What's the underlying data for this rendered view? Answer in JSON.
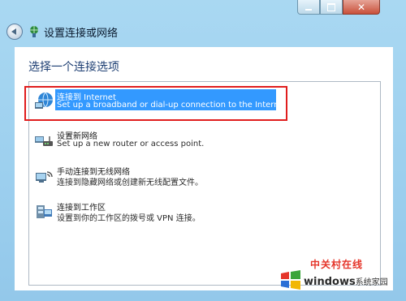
{
  "window": {
    "title": "设置连接或网络",
    "close_glyph": "✕"
  },
  "page": {
    "heading": "选择一个连接选项"
  },
  "options": [
    {
      "title": "连接到 Internet",
      "description": "Set up a broadband or dial-up connection to the Internet.",
      "icon": "globe-network-icon",
      "selected": true
    },
    {
      "title": "设置新网络",
      "description": "Set up a new router or access point.",
      "icon": "router-icon",
      "selected": false
    },
    {
      "title": "手动连接到无线网络",
      "description": "连接到隐藏网络或创建新无线配置文件。",
      "icon": "wireless-network-icon",
      "selected": false
    },
    {
      "title": "连接到工作区",
      "description": "设置到你的工作区的拨号或 VPN 连接。",
      "icon": "workplace-vpn-icon",
      "selected": false
    }
  ],
  "watermark": {
    "line1": "中关村在线",
    "brand": "windows",
    "sub": "系统家园"
  },
  "colors": {
    "selection": "#3399ff",
    "highlight_box": "#e01d1d",
    "heading": "#1e3f73"
  }
}
